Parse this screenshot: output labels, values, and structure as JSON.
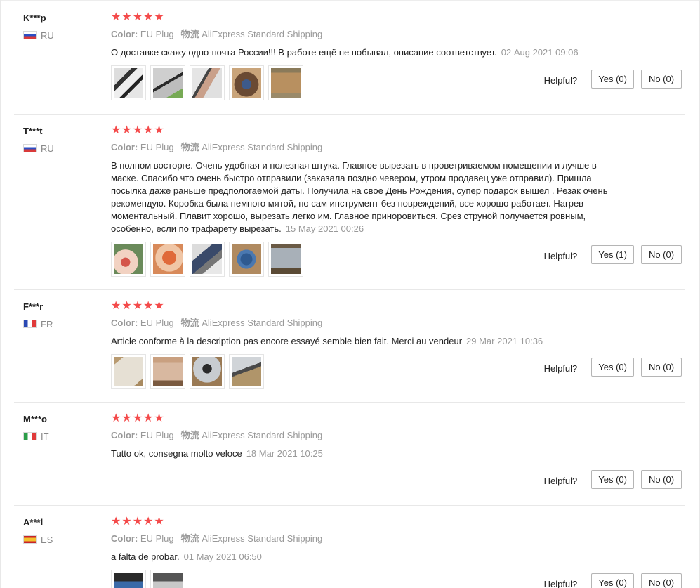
{
  "labels": {
    "color_label": "Color:",
    "logistics_label": "物流",
    "helpful_label": "Helpful?"
  },
  "colors": {
    "star": "#f44a4a",
    "muted": "#999999",
    "border": "#e8e8e8"
  },
  "reviews": [
    {
      "username": "K***p",
      "country": "RU",
      "flag": "russia-flag",
      "stars": "★★★★★",
      "color": "EU Plug",
      "shipping": "AliExpress Standard Shipping",
      "text": "О доставке скажу одно-почта России!!! В работе ещё не побывал, описание соответствует.",
      "date": "02 Aug 2021 09:06",
      "photo_count": 5,
      "yes": "Yes (0)",
      "no": "No (0)"
    },
    {
      "username": "T***t",
      "country": "RU",
      "flag": "russia-flag",
      "stars": "★★★★★",
      "color": "EU Plug",
      "shipping": "AliExpress Standard Shipping",
      "text": "В полном восторге. Очень удобная и полезная штука. Главное вырезать в проветриваемом помещении и лучше в маске. Спасибо что очень быстро отправили (заказала поздно чевером, утром продавец уже отправил). Пришла посылка даже раньше предпологаемой даты. Получила на свое День Рождения, супер подарок вышел . Резак очень рекомендую. Коробка была немного мятой, но сам инструмент без повреждений, все хорошо работает. Нагрев моментальный. Плавит хорошо, вырезать легко им. Главное приноровиться. Срез струной получается ровным, особенно, если по трафарету вырезать.",
      "date": "15 May 2021 00:26",
      "photo_count": 5,
      "yes": "Yes (1)",
      "no": "No (0)"
    },
    {
      "username": "F***r",
      "country": "FR",
      "flag": "france-flag",
      "stars": "★★★★★",
      "color": "EU Plug",
      "shipping": "AliExpress Standard Shipping",
      "text": "Article conforme à la description pas encore essayé semble bien fait. Merci au vendeur",
      "date": "29 Mar 2021 10:36",
      "photo_count": 4,
      "yes": "Yes (0)",
      "no": "No (0)"
    },
    {
      "username": "M***o",
      "country": "IT",
      "flag": "italy-flag",
      "stars": "★★★★★",
      "color": "EU Plug",
      "shipping": "AliExpress Standard Shipping",
      "text": "Tutto ok, consegna molto veloce",
      "date": "18 Mar 2021 10:25",
      "photo_count": 0,
      "yes": "Yes (0)",
      "no": "No (0)"
    },
    {
      "username": "A***l",
      "country": "ES",
      "flag": "spain-flag",
      "stars": "★★★★★",
      "color": "EU Plug",
      "shipping": "AliExpress Standard Shipping",
      "text": "a falta de probar.",
      "date": "01 May 2021 06:50",
      "photo_count": 2,
      "yes": "Yes (0)",
      "no": "No (0)"
    }
  ]
}
